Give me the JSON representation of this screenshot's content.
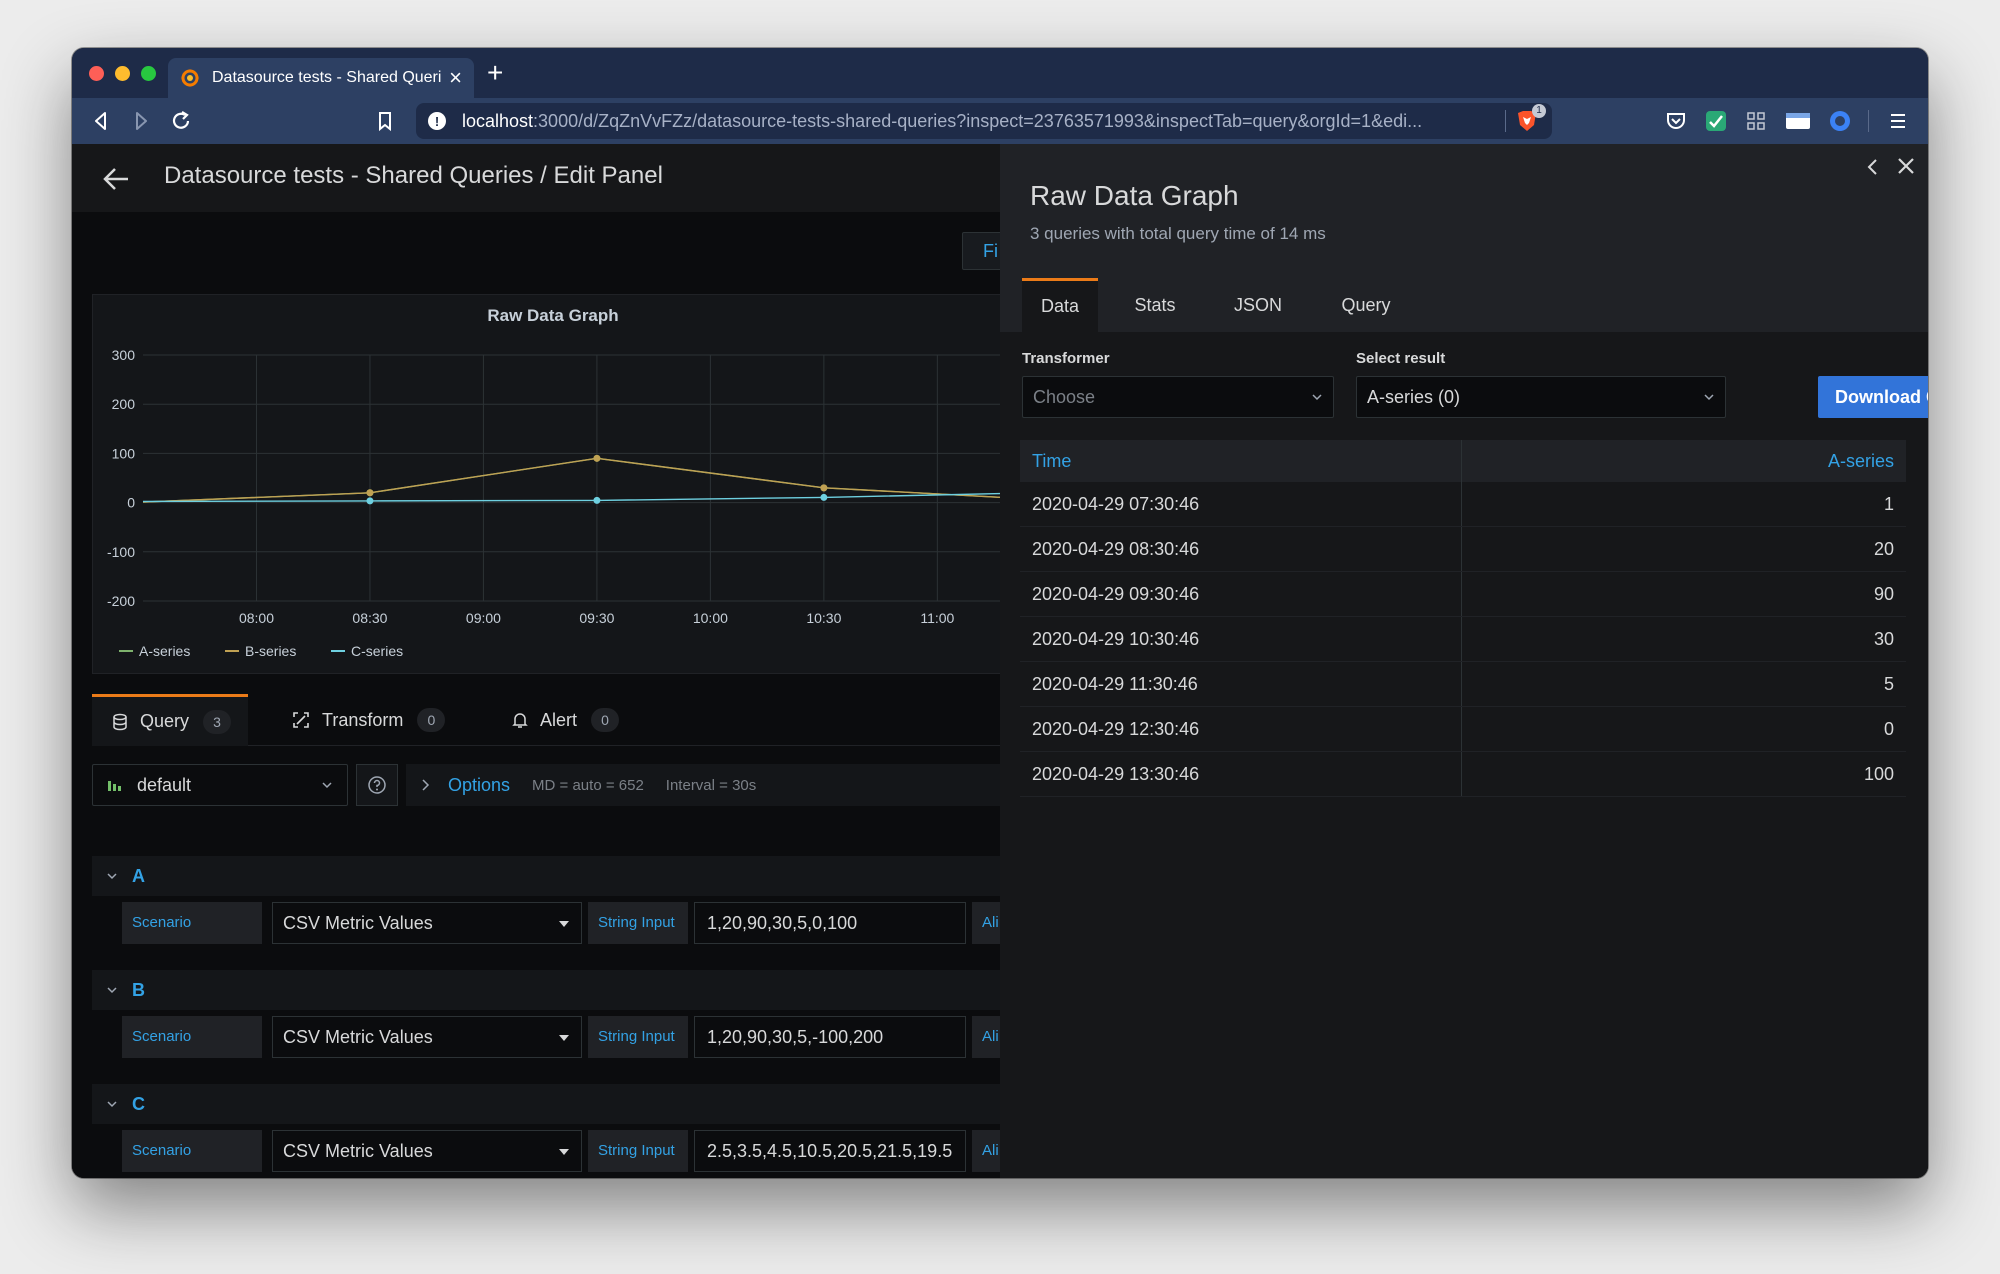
{
  "browser": {
    "tab_title": "Datasource tests - Shared Queri",
    "tab_close": "×",
    "new_tab": "+",
    "url_host": "localhost",
    "url_rest": ":3000/d/ZqZnVvFZz/datasource-tests-shared-queries?inspect=23763571993&inspectTab=query&orgId=1&edi...",
    "shield_badge": "1"
  },
  "header": {
    "title": "Datasource tests - Shared Queries / Edit Panel",
    "fi_button": "Fi"
  },
  "chart_data": {
    "type": "line",
    "title": "Raw Data Graph",
    "x_tick_labels": [
      "08:00",
      "08:30",
      "09:00",
      "09:30",
      "10:00",
      "10:30",
      "11:00"
    ],
    "y_tick_labels": [
      "300",
      "200",
      "100",
      "0",
      "-100",
      "-200"
    ],
    "ylim": [
      -200,
      300
    ],
    "grid": true,
    "legend_position": "bottom-left",
    "visible_time_range": [
      "07:30",
      "11:20"
    ],
    "series": [
      {
        "name": "A-series",
        "color": "#7eb26d",
        "x": [
          "07:30",
          "08:30",
          "09:30",
          "10:30",
          "11:30"
        ],
        "values": [
          1,
          20,
          90,
          30,
          5
        ]
      },
      {
        "name": "B-series",
        "color": "#c0a153",
        "x": [
          "07:30",
          "08:30",
          "09:30",
          "10:30",
          "11:30"
        ],
        "values": [
          1,
          20,
          90,
          30,
          5
        ]
      },
      {
        "name": "C-series",
        "color": "#6ed0e0",
        "x": [
          "07:30",
          "08:30",
          "09:30",
          "10:30",
          "11:30"
        ],
        "values": [
          2.5,
          3.5,
          4.5,
          10.5,
          20.5
        ]
      }
    ]
  },
  "query_tabs": [
    {
      "label": "Query",
      "count": "3"
    },
    {
      "label": "Transform",
      "count": "0"
    },
    {
      "label": "Alert",
      "count": "0"
    }
  ],
  "datasource": {
    "name": "default",
    "options_label": "Options",
    "md": "MD = auto = 652",
    "interval": "Interval = 30s"
  },
  "queries": [
    {
      "letter": "A",
      "scenario_label": "Scenario",
      "scenario": "CSV Metric Values",
      "input_label": "String Input",
      "input_value": "1,20,90,30,5,0,100",
      "alias_label": "Ali"
    },
    {
      "letter": "B",
      "scenario_label": "Scenario",
      "scenario": "CSV Metric Values",
      "input_label": "String Input",
      "input_value": "1,20,90,30,5,-100,200",
      "alias_label": "Ali"
    },
    {
      "letter": "C",
      "scenario_label": "Scenario",
      "scenario": "CSV Metric Values",
      "input_label": "String Input",
      "input_value": "2.5,3.5,4.5,10.5,20.5,21.5,19.5",
      "alias_label": "Ali"
    }
  ],
  "inspect": {
    "title": "Raw Data Graph",
    "subtitle": "3 queries with total query time of 14 ms",
    "tabs": [
      "Data",
      "Stats",
      "JSON",
      "Query"
    ],
    "transformer_label": "Transformer",
    "transformer_placeholder": "Choose",
    "select_result_label": "Select result",
    "select_result_value": "A-series (0)",
    "download_button": "Download CSV",
    "table": {
      "columns": [
        "Time",
        "A-series"
      ],
      "rows": [
        [
          "2020-04-29 07:30:46",
          "1"
        ],
        [
          "2020-04-29 08:30:46",
          "20"
        ],
        [
          "2020-04-29 09:30:46",
          "90"
        ],
        [
          "2020-04-29 10:30:46",
          "30"
        ],
        [
          "2020-04-29 11:30:46",
          "5"
        ],
        [
          "2020-04-29 12:30:46",
          "0"
        ],
        [
          "2020-04-29 13:30:46",
          "100"
        ]
      ]
    }
  },
  "colors": {
    "accent_blue": "#33a2e5",
    "primary_button": "#3274d9",
    "active_tab_border": "#eb7b18",
    "background": "#0b0c0e"
  }
}
